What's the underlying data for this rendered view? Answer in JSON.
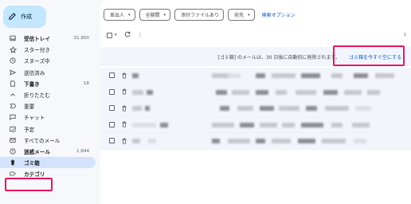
{
  "compose": {
    "label": "作成"
  },
  "nav": [
    {
      "id": "inbox",
      "label": "受信トレイ",
      "count": "31,950",
      "icon": "inbox-icon",
      "bold": true
    },
    {
      "id": "starred",
      "label": "スター付き",
      "count": "",
      "icon": "star-icon"
    },
    {
      "id": "snoozed",
      "label": "スヌーズ中",
      "count": "",
      "icon": "clock-icon"
    },
    {
      "id": "sent",
      "label": "送信済み",
      "count": "",
      "icon": "send-icon"
    },
    {
      "id": "drafts",
      "label": "下書き",
      "count": "18",
      "icon": "draft-icon",
      "bold": true
    },
    {
      "id": "less",
      "label": "折りたたむ",
      "count": "",
      "icon": "chevron-up-icon"
    },
    {
      "id": "important",
      "label": "重要",
      "count": "",
      "icon": "important-icon"
    },
    {
      "id": "chat",
      "label": "チャット",
      "count": "",
      "icon": "chat-icon"
    },
    {
      "id": "scheduled",
      "label": "予定",
      "count": "",
      "icon": "scheduled-icon"
    },
    {
      "id": "all",
      "label": "すべてのメール",
      "count": "",
      "icon": "all-mail-icon"
    },
    {
      "id": "spam",
      "label": "迷惑メール",
      "count": "1,844",
      "icon": "spam-icon",
      "bold": true
    },
    {
      "id": "trash",
      "label": "ゴミ箱",
      "count": "",
      "icon": "trash-icon",
      "active": true
    },
    {
      "id": "categories",
      "label": "カテゴリ",
      "count": "",
      "icon": "label-icon",
      "bold": true
    }
  ],
  "filters": [
    {
      "label": "差出人"
    },
    {
      "label": "全期間"
    },
    {
      "label": "添付ファイルあり",
      "nocaret": true
    },
    {
      "label": "宛先"
    }
  ],
  "advanced_search": "検索オプション",
  "banner": {
    "message": "[ゴミ箱] のメールは、30 日後に自動的に削除されます。",
    "action": "ゴミ箱を今すぐ空にする"
  },
  "pagination": "1",
  "row_count": 6,
  "colors": {
    "highlight": "#e8175d",
    "accent": "#0b57d0",
    "compose_bg": "#c2e7ff",
    "active_bg": "#d3e3fd"
  }
}
